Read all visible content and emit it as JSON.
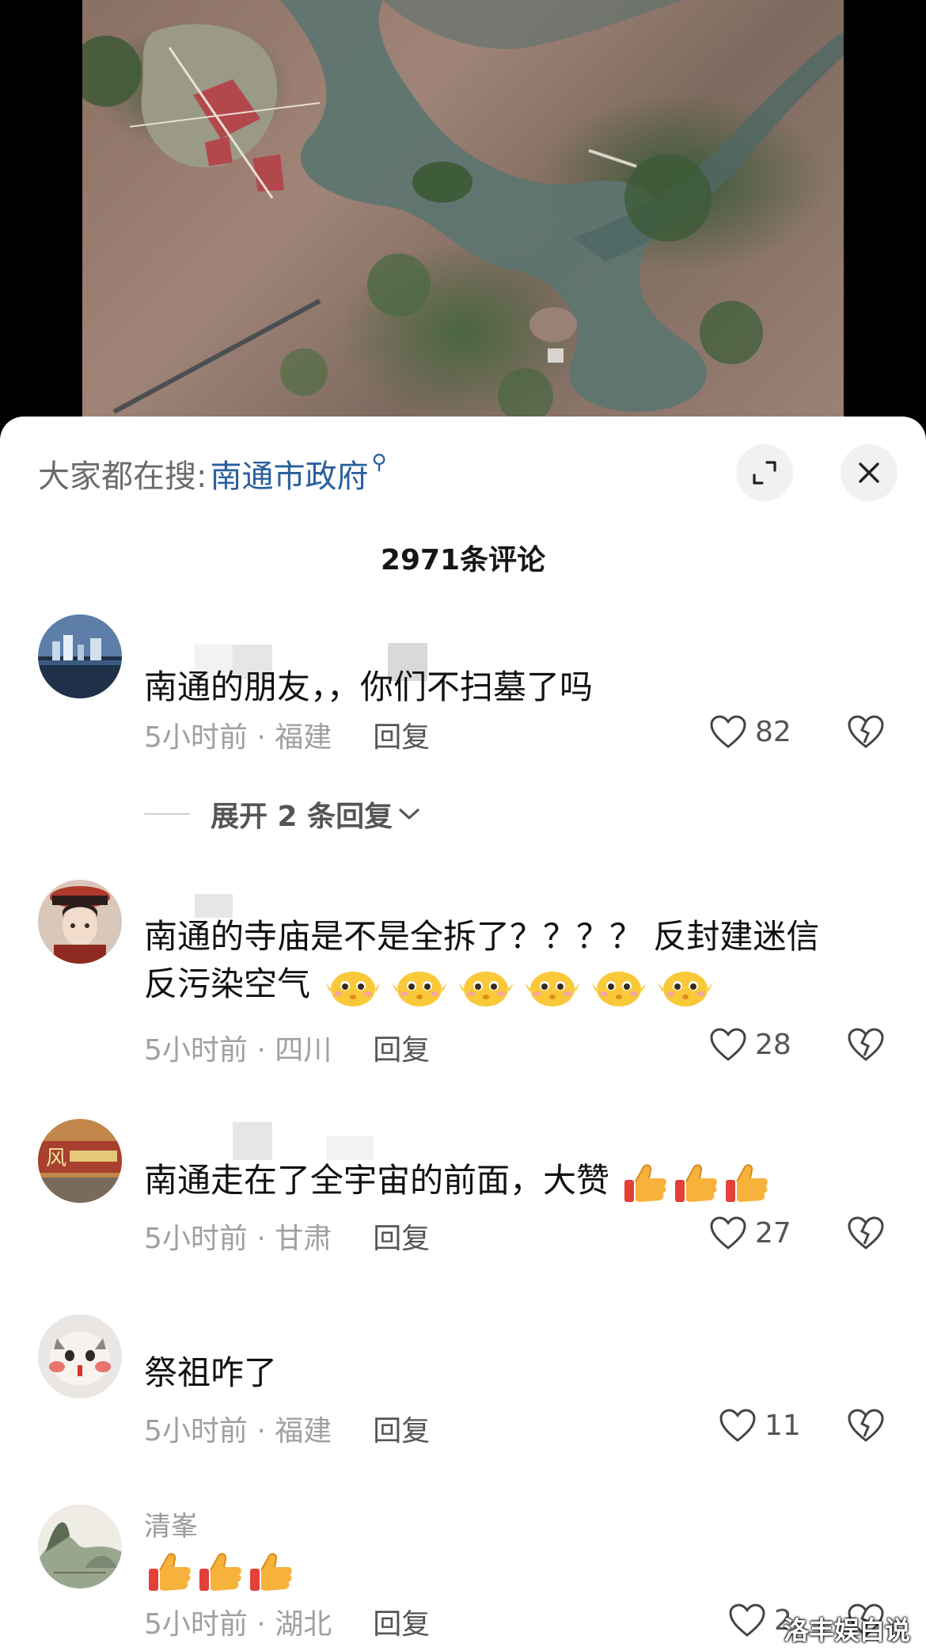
{
  "search": {
    "prefix": "大家都在搜:",
    "term": "南通市政府",
    "search_glyph": "⚲"
  },
  "header": {
    "comment_count": "2971条评论",
    "expand_icon": "expand-arrows-icon",
    "close_icon": "close-icon"
  },
  "comments": [
    {
      "username": "",
      "text": "南通的朋友，，你们不扫墓了吗",
      "time": "5小时前 · 福建",
      "reply": "回复",
      "likes": "82",
      "expand_replies": "展开 2 条回复"
    },
    {
      "username": "",
      "text_line1": "南通的寺庙是不是全拆了？？？？  反封建迷信",
      "text_line2": "反污染空气",
      "emoji_name": "pleading-chick-emoji",
      "emoji_count": 6,
      "time": "5小时前 · 四川",
      "reply": "回复",
      "likes": "28"
    },
    {
      "username": "",
      "text": "南通走在了全宇宙的前面，大赞",
      "emoji_name": "thumbs-up-emoji",
      "emoji_count": 3,
      "time": "5小时前 · 甘肃",
      "reply": "回复",
      "likes": "27"
    },
    {
      "username": "",
      "text": "祭祖咋了",
      "time": "5小时前 · 福建",
      "reply": "回复",
      "likes": "11"
    },
    {
      "username": "清峯",
      "emoji_name": "thumbs-up-emoji",
      "emoji_count": 3,
      "time": "5小时前 · 湖北",
      "reply": "回复",
      "likes": "2"
    }
  ],
  "watermark": "洛丰娱白说",
  "colors": {
    "link": "#2a5f9e",
    "meta_gray": "#a0a0a0",
    "sheet_bg": "#ffffff"
  }
}
